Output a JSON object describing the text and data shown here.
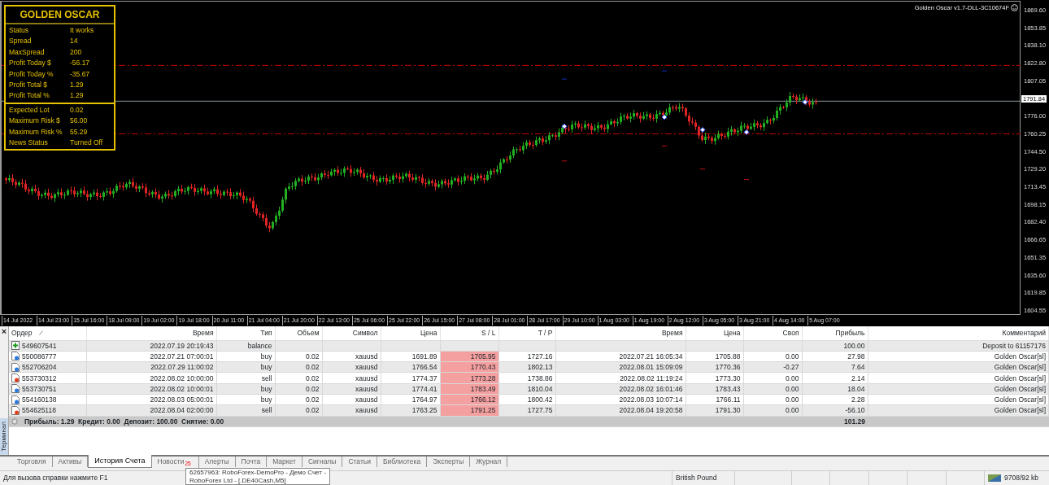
{
  "chart": {
    "ea_label": "Golden Oscar v1.7-DLL-3C10674F",
    "current_price": "1791.84",
    "price_axis": [
      "1869.60",
      "1853.85",
      "1838.10",
      "1822.80",
      "1807.05",
      "1776.00",
      "1760.25",
      "1744.50",
      "1729.20",
      "1713.45",
      "1698.15",
      "1682.40",
      "1666.65",
      "1651.35",
      "1635.60",
      "1619.85",
      "1604.55"
    ],
    "time_axis": [
      "14 Jul 2022",
      "14 Jul 23:00",
      "15 Jul 16:00",
      "18 Jul 09:00",
      "19 Jul 02:00",
      "19 Jul 18:00",
      "20 Jul 11:00",
      "21 Jul 04:00",
      "21 Jul 20:00",
      "22 Jul 13:00",
      "25 Jul 06:00",
      "25 Jul 22:00",
      "26 Jul 15:00",
      "27 Jul 08:00",
      "28 Jul 01:00",
      "28 Jul 17:00",
      "29 Jul 10:00",
      "1 Aug 03:00",
      "1 Aug 19:00",
      "2 Aug 12:00",
      "3 Aug 05:00",
      "3 Aug 21:00",
      "4 Aug 14:00",
      "5 Aug 07:00"
    ]
  },
  "panel": {
    "title": "GOLDEN OSCAR",
    "groups": [
      [
        {
          "label": "Status",
          "value": "It works"
        },
        {
          "label": "Spread",
          "value": "14"
        },
        {
          "label": "MaxSpread",
          "value": "200"
        },
        {
          "label": "Profit Today $",
          "value": "-56.17"
        },
        {
          "label": "Profit Today %",
          "value": "-35.67"
        },
        {
          "label": "Profit Total $",
          "value": "1.29"
        },
        {
          "label": "Profit Total %",
          "value": "1.29"
        }
      ],
      [
        {
          "label": "Expected Lot",
          "value": "0.02"
        },
        {
          "label": "Maximum Risk $",
          "value": "56.00"
        },
        {
          "label": "Maximum Risk %",
          "value": "55.29"
        },
        {
          "label": "News Status",
          "value": "Turned Off"
        }
      ]
    ]
  },
  "table": {
    "columns": [
      "Ордер",
      "Время",
      "Тип",
      "Объем",
      "Символ",
      "Цена",
      "S / L",
      "T / P",
      "Время",
      "Цена",
      "Своп",
      "Прибыль",
      "Комментарий"
    ],
    "rows": [
      {
        "kind": "balance",
        "cells": [
          "549607541",
          "2022.07.19 20:19:43",
          "balance",
          "",
          "",
          "",
          "",
          "",
          "",
          "",
          "",
          "100.00",
          "Deposit to 61157176"
        ]
      },
      {
        "kind": "buy",
        "cells": [
          "550086777",
          "2022.07.21 07:00:01",
          "buy",
          "0.02",
          "xauusd",
          "1691.89",
          "1705.95",
          "1727.16",
          "2022.07.21 16:05:34",
          "1705.88",
          "0.00",
          "27.98",
          "Golden Oscar[sl]"
        ]
      },
      {
        "kind": "buy",
        "cells": [
          "552706204",
          "2022.07.29 11:00:02",
          "buy",
          "0.02",
          "xauusd",
          "1766.54",
          "1770.43",
          "1802.13",
          "2022.08.01 15:09:09",
          "1770.36",
          "-0.27",
          "7.64",
          "Golden Oscar[sl]"
        ]
      },
      {
        "kind": "sell",
        "cells": [
          "553730312",
          "2022.08.02 10:00:00",
          "sell",
          "0.02",
          "xauusd",
          "1774.37",
          "1773.28",
          "1738.86",
          "2022.08.02 11:19:24",
          "1773.30",
          "0.00",
          "2.14",
          "Golden Oscar[sl]"
        ]
      },
      {
        "kind": "buy",
        "cells": [
          "553730751",
          "2022.08.02 10:00:01",
          "buy",
          "0.02",
          "xauusd",
          "1774.41",
          "1783.49",
          "1810.04",
          "2022.08.02 16:01:46",
          "1783.43",
          "0.00",
          "18.04",
          "Golden Oscar[sl]"
        ]
      },
      {
        "kind": "buy",
        "cells": [
          "554160138",
          "2022.08.03 05:00:01",
          "buy",
          "0.02",
          "xauusd",
          "1764.97",
          "1766.12",
          "1800.42",
          "2022.08.03 10:07:14",
          "1766.11",
          "0.00",
          "2.28",
          "Golden Oscar[sl]"
        ]
      },
      {
        "kind": "sell",
        "cells": [
          "554625118",
          "2022.08.04 02:00:00",
          "sell",
          "0.02",
          "xauusd",
          "1763.25",
          "1791.25",
          "1727.75",
          "2022.08.04 19:20:58",
          "1791.30",
          "0.00",
          "-56.10",
          "Golden Oscar[sl]"
        ]
      }
    ],
    "summary": "Прибыль: 1.29  Кредит: 0.00  Депозит: 100.00  Снятие: 0.00",
    "summary_total": "101.29"
  },
  "terminal_label": "Терминал",
  "close_glyph": "×",
  "tabs": [
    {
      "label": "Торговля",
      "selected": false
    },
    {
      "label": "Активы",
      "selected": false
    },
    {
      "label": "История Счета",
      "selected": true
    },
    {
      "label": "Новости",
      "badge": "25",
      "selected": false
    },
    {
      "label": "Алерты",
      "selected": false
    },
    {
      "label": "Почта",
      "selected": false
    },
    {
      "label": "Маркет",
      "selected": false
    },
    {
      "label": "Сигналы",
      "selected": false
    },
    {
      "label": "Статьи",
      "selected": false
    },
    {
      "label": "Библиотека",
      "selected": false
    },
    {
      "label": "Эксперты",
      "selected": false
    },
    {
      "label": "Журнал",
      "selected": false
    }
  ],
  "tooltip": [
    "62657963: RoboForex-DemoPro - Демо Счет -",
    "RoboForex Ltd - [.DE40Cash,M5]"
  ],
  "status_bar": {
    "help": "Для вызова справки нажмите F1",
    "profile": "British Pound",
    "traffic": "9708/92 kb"
  }
}
